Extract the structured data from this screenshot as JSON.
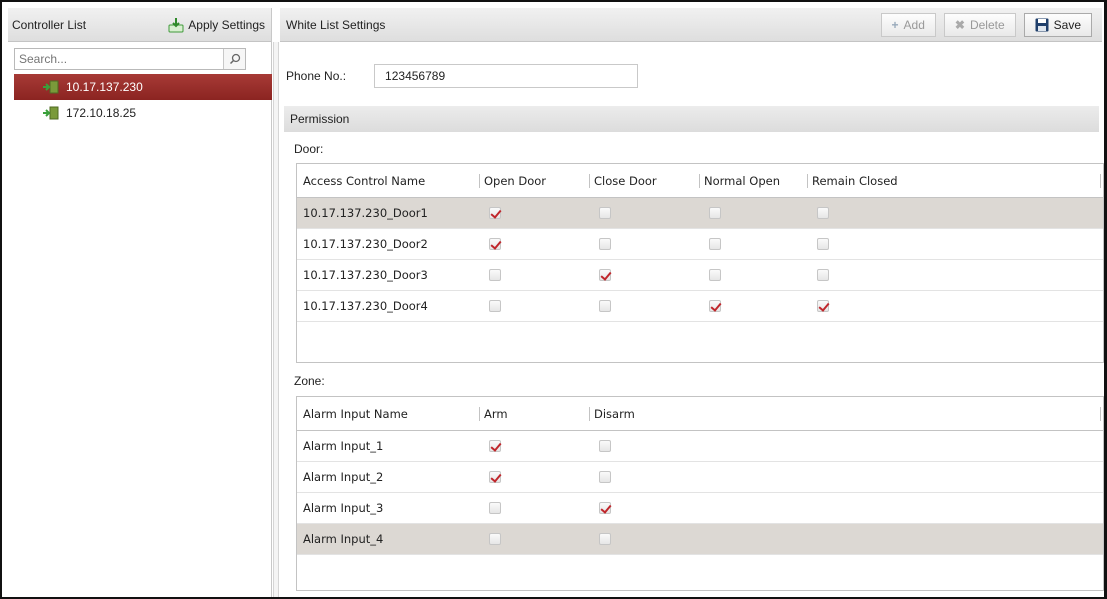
{
  "left_panel": {
    "title": "Controller List",
    "apply_label": "Apply Settings",
    "search_placeholder": "Search...",
    "devices": [
      {
        "label": "10.17.137.230",
        "selected": true
      },
      {
        "label": "172.10.18.25",
        "selected": false
      }
    ]
  },
  "right_panel": {
    "title": "White List Settings",
    "toolbar": {
      "add_label": "Add",
      "delete_label": "Delete",
      "save_label": "Save"
    },
    "phone": {
      "label": "Phone No.:",
      "value": "123456789"
    },
    "permission_label": "Permission",
    "door": {
      "label": "Door:",
      "columns": [
        "Access Control Name",
        "Open Door",
        "Close Door",
        "Normal Open",
        "Remain Closed"
      ],
      "rows": [
        {
          "name": "10.17.137.230_Door1",
          "checks": [
            true,
            false,
            false,
            false
          ],
          "highlight": true
        },
        {
          "name": "10.17.137.230_Door2",
          "checks": [
            true,
            false,
            false,
            false
          ],
          "highlight": false
        },
        {
          "name": "10.17.137.230_Door3",
          "checks": [
            false,
            true,
            false,
            false
          ],
          "highlight": false
        },
        {
          "name": "10.17.137.230_Door4",
          "checks": [
            false,
            false,
            true,
            true
          ],
          "highlight": false
        }
      ]
    },
    "zone": {
      "label": "Zone:",
      "columns": [
        "Alarm Input Name",
        "Arm",
        "Disarm"
      ],
      "rows": [
        {
          "name": "Alarm Input_1",
          "checks": [
            true,
            false
          ],
          "highlight": false
        },
        {
          "name": "Alarm Input_2",
          "checks": [
            true,
            false
          ],
          "highlight": false
        },
        {
          "name": "Alarm Input_3",
          "checks": [
            false,
            true
          ],
          "highlight": false
        },
        {
          "name": "Alarm Input_4",
          "checks": [
            false,
            false
          ],
          "highlight": true
        }
      ]
    }
  },
  "colors": {
    "selection": "#9a2e2a",
    "check": "#c0262b",
    "row_highlight": "#dcd8d3"
  }
}
